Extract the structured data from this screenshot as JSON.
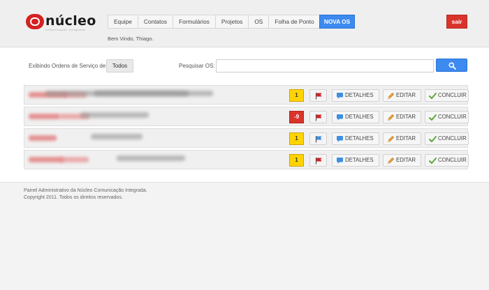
{
  "brand": {
    "name": "núcleo",
    "tagline": "comunicação integrada"
  },
  "nav": {
    "items": [
      {
        "label": "Equipe"
      },
      {
        "label": "Contatos"
      },
      {
        "label": "Formulários"
      },
      {
        "label": "Projetos"
      },
      {
        "label": "OS"
      },
      {
        "label": "Folha de Ponto"
      }
    ]
  },
  "header": {
    "new_os_label": "NOVA OS",
    "logout_label": "sair",
    "welcome": "Bem Vindo, Thiago."
  },
  "filter": {
    "label": "Exibindo Ordens de Serviço de:",
    "value": "Todos"
  },
  "search": {
    "label": "Pesquisar OS:",
    "value": "",
    "placeholder": ""
  },
  "actions": {
    "details": "DETALHES",
    "edit": "EDITAR",
    "conclude": "CONCLUIR"
  },
  "orders": [
    {
      "count": "1",
      "count_color": "yellow",
      "flag_color": "red"
    },
    {
      "count": "-9",
      "count_color": "red",
      "flag_color": "red"
    },
    {
      "count": "1",
      "count_color": "yellow",
      "flag_color": "blue"
    },
    {
      "count": "1",
      "count_color": "yellow",
      "flag_color": "red"
    }
  ],
  "footer": {
    "line1": "Painel Administrativo da Núcleo Comunicação Integrada.",
    "line2": "Copyright 2011. Todos os direitos reservados."
  },
  "colors": {
    "primary_blue": "#3d8af0",
    "danger_red": "#d9342b",
    "badge_yellow": "#ffd400",
    "flag_red": "#d42121",
    "flag_blue": "#3a8ee0"
  }
}
